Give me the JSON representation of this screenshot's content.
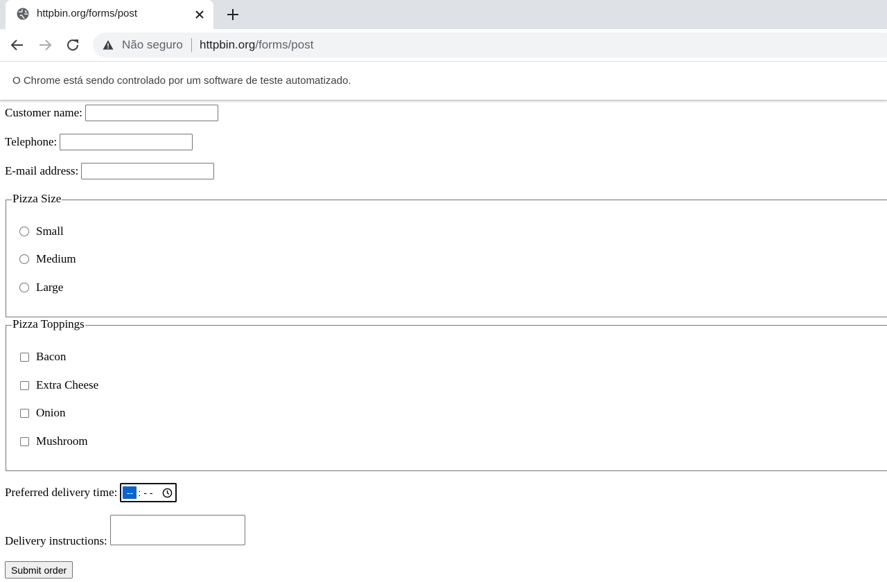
{
  "browser": {
    "tab": {
      "title": "httpbin.org/forms/post"
    },
    "omnibox": {
      "security_label": "Não seguro",
      "url_host": "httpbin.org",
      "url_path": "/forms/post"
    },
    "infobar": {
      "message": "O Chrome está sendo controlado por um software de teste automatizado."
    }
  },
  "form": {
    "customer_name": {
      "label": "Customer name:",
      "value": ""
    },
    "telephone": {
      "label": "Telephone:",
      "value": ""
    },
    "email": {
      "label": "E-mail address:",
      "value": ""
    },
    "pizza_size": {
      "legend": "Pizza Size",
      "options": [
        {
          "label": "Small",
          "checked": false
        },
        {
          "label": "Medium",
          "checked": false
        },
        {
          "label": "Large",
          "checked": false
        }
      ]
    },
    "pizza_toppings": {
      "legend": "Pizza Toppings",
      "options": [
        {
          "label": "Bacon",
          "checked": false
        },
        {
          "label": "Extra Cheese",
          "checked": false
        },
        {
          "label": "Onion",
          "checked": false
        },
        {
          "label": "Mushroom",
          "checked": false
        }
      ]
    },
    "delivery_time": {
      "label": "Preferred delivery time:",
      "hours": "--",
      "separator": ":",
      "minutes": "- -"
    },
    "delivery_instructions": {
      "label": "Delivery instructions:",
      "value": ""
    },
    "submit_label": "Submit order"
  },
  "colors": {
    "tabstrip": "#dee1e6",
    "omnibox": "#f1f3f4",
    "selection": "#0b63ce"
  }
}
